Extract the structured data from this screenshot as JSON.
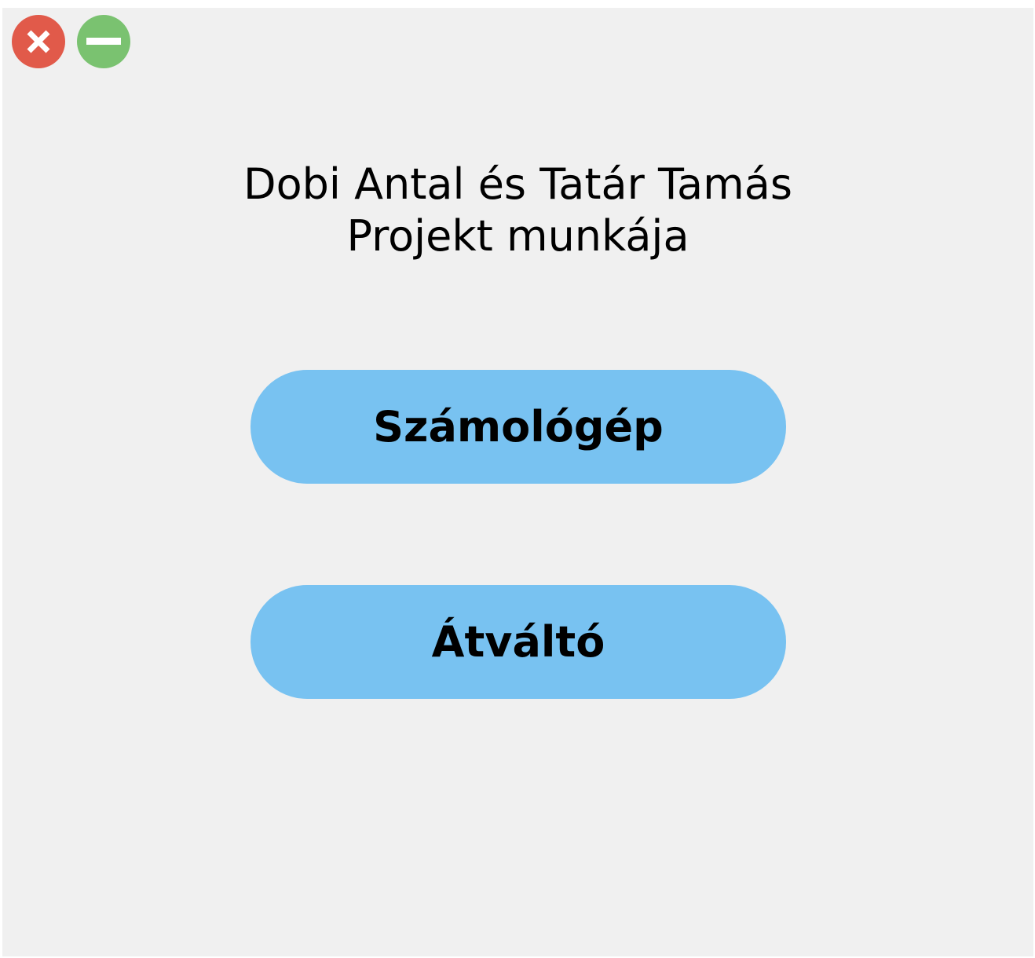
{
  "window": {
    "controls": [
      {
        "name": "close",
        "icon": "close-icon",
        "color": "#e15a4a"
      },
      {
        "name": "minimize",
        "icon": "minimize-icon",
        "color": "#7ac270"
      }
    ]
  },
  "header": {
    "title_line1": "Dobi Antal és Tatár Tamás",
    "title_line2": "Projekt munkája"
  },
  "buttons": {
    "calculator_label": "Számológép",
    "converter_label": "Átváltó",
    "color": "#78c2f1"
  }
}
